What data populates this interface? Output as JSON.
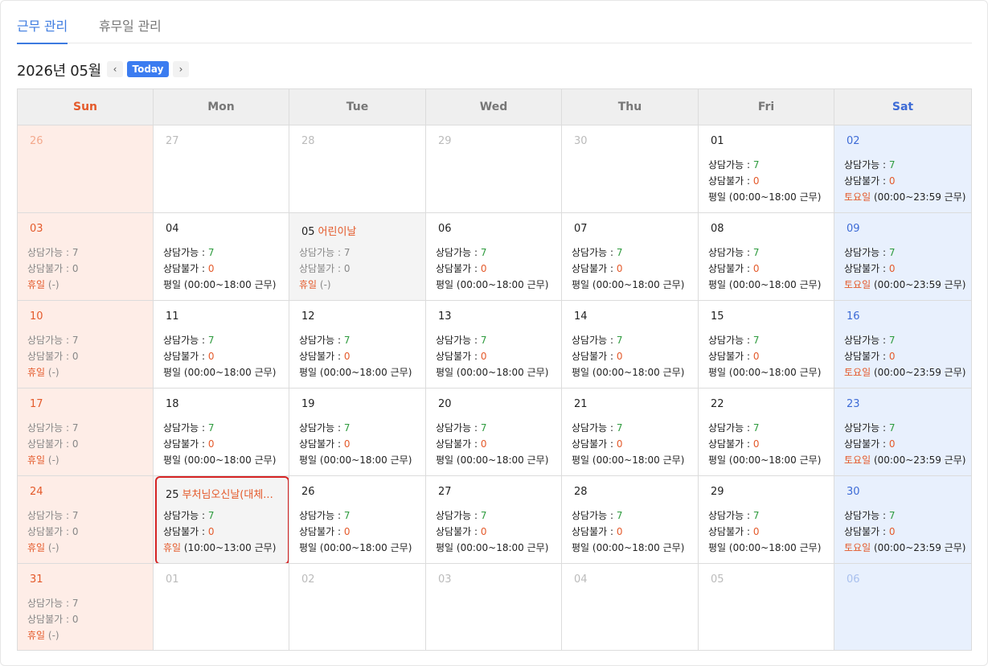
{
  "tabs": [
    {
      "label": "근무 관리",
      "active": true
    },
    {
      "label": "휴무일 관리",
      "active": false
    }
  ],
  "toolbar": {
    "month": "2026년 05월",
    "prev_icon": "‹",
    "next_icon": "›",
    "today_label": "Today"
  },
  "colors": {
    "accent": "#3b7cf0",
    "sunday": "#e45a2b",
    "saturday": "#3d6bd6",
    "available": "#2e9b3e",
    "selected_border": "#d62424"
  },
  "weekdays": [
    "Sun",
    "Mon",
    "Tue",
    "Wed",
    "Thu",
    "Fri",
    "Sat"
  ],
  "labels": {
    "available": "상담가능 : ",
    "unavailable": "상담불가 : "
  },
  "weeks": [
    [
      {
        "day": "26",
        "other": true
      },
      {
        "day": "27",
        "other": true
      },
      {
        "day": "28",
        "other": true
      },
      {
        "day": "29",
        "other": true
      },
      {
        "day": "30",
        "other": true
      },
      {
        "day": "01",
        "available": "7",
        "unavailable": "0",
        "type": "평일",
        "hours": " (00:00~18:00 근무)"
      },
      {
        "day": "02",
        "available": "7",
        "unavailable": "0",
        "type": "토요일",
        "hours": " (00:00~23:59 근무)"
      }
    ],
    [
      {
        "day": "03",
        "available": "7",
        "unavailable": "0",
        "type": "휴일",
        "hours": " (-)"
      },
      {
        "day": "04",
        "available": "7",
        "unavailable": "0",
        "type": "평일",
        "hours": " (00:00~18:00 근무)"
      },
      {
        "day": "05",
        "holiday": "어린이날",
        "available": "7",
        "unavailable": "0",
        "type": "휴일",
        "hours": " (-)"
      },
      {
        "day": "06",
        "available": "7",
        "unavailable": "0",
        "type": "평일",
        "hours": " (00:00~18:00 근무)"
      },
      {
        "day": "07",
        "available": "7",
        "unavailable": "0",
        "type": "평일",
        "hours": " (00:00~18:00 근무)"
      },
      {
        "day": "08",
        "available": "7",
        "unavailable": "0",
        "type": "평일",
        "hours": " (00:00~18:00 근무)"
      },
      {
        "day": "09",
        "available": "7",
        "unavailable": "0",
        "type": "토요일",
        "hours": " (00:00~23:59 근무)"
      }
    ],
    [
      {
        "day": "10",
        "available": "7",
        "unavailable": "0",
        "type": "휴일",
        "hours": " (-)"
      },
      {
        "day": "11",
        "available": "7",
        "unavailable": "0",
        "type": "평일",
        "hours": " (00:00~18:00 근무)"
      },
      {
        "day": "12",
        "available": "7",
        "unavailable": "0",
        "type": "평일",
        "hours": " (00:00~18:00 근무)"
      },
      {
        "day": "13",
        "available": "7",
        "unavailable": "0",
        "type": "평일",
        "hours": " (00:00~18:00 근무)"
      },
      {
        "day": "14",
        "available": "7",
        "unavailable": "0",
        "type": "평일",
        "hours": " (00:00~18:00 근무)"
      },
      {
        "day": "15",
        "available": "7",
        "unavailable": "0",
        "type": "평일",
        "hours": " (00:00~18:00 근무)"
      },
      {
        "day": "16",
        "available": "7",
        "unavailable": "0",
        "type": "토요일",
        "hours": " (00:00~23:59 근무)"
      }
    ],
    [
      {
        "day": "17",
        "available": "7",
        "unavailable": "0",
        "type": "휴일",
        "hours": " (-)"
      },
      {
        "day": "18",
        "available": "7",
        "unavailable": "0",
        "type": "평일",
        "hours": " (00:00~18:00 근무)"
      },
      {
        "day": "19",
        "available": "7",
        "unavailable": "0",
        "type": "평일",
        "hours": " (00:00~18:00 근무)"
      },
      {
        "day": "20",
        "available": "7",
        "unavailable": "0",
        "type": "평일",
        "hours": " (00:00~18:00 근무)"
      },
      {
        "day": "21",
        "available": "7",
        "unavailable": "0",
        "type": "평일",
        "hours": " (00:00~18:00 근무)"
      },
      {
        "day": "22",
        "available": "7",
        "unavailable": "0",
        "type": "평일",
        "hours": " (00:00~18:00 근무)"
      },
      {
        "day": "23",
        "available": "7",
        "unavailable": "0",
        "type": "토요일",
        "hours": " (00:00~23:59 근무)"
      }
    ],
    [
      {
        "day": "24",
        "available": "7",
        "unavailable": "0",
        "type": "휴일",
        "hours": " (-)"
      },
      {
        "day": "25",
        "holiday": "부처님오신날(대체...",
        "selected": true,
        "available": "7",
        "unavailable": "0",
        "type": "휴일",
        "hours": " (10:00~13:00 근무)"
      },
      {
        "day": "26",
        "available": "7",
        "unavailable": "0",
        "type": "평일",
        "hours": " (00:00~18:00 근무)"
      },
      {
        "day": "27",
        "available": "7",
        "unavailable": "0",
        "type": "평일",
        "hours": " (00:00~18:00 근무)"
      },
      {
        "day": "28",
        "available": "7",
        "unavailable": "0",
        "type": "평일",
        "hours": " (00:00~18:00 근무)"
      },
      {
        "day": "29",
        "available": "7",
        "unavailable": "0",
        "type": "평일",
        "hours": " (00:00~18:00 근무)"
      },
      {
        "day": "30",
        "available": "7",
        "unavailable": "0",
        "type": "토요일",
        "hours": " (00:00~23:59 근무)"
      }
    ],
    [
      {
        "day": "31",
        "available": "7",
        "unavailable": "0",
        "type": "휴일",
        "hours": " (-)"
      },
      {
        "day": "01",
        "other": true
      },
      {
        "day": "02",
        "other": true
      },
      {
        "day": "03",
        "other": true
      },
      {
        "day": "04",
        "other": true
      },
      {
        "day": "05",
        "other": true
      },
      {
        "day": "06",
        "other": true
      }
    ]
  ]
}
